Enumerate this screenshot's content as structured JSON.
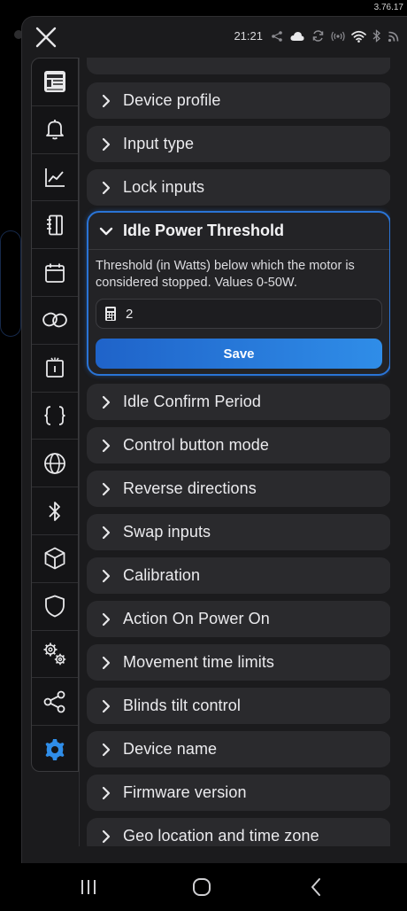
{
  "app_version": "3.76.17",
  "status_bar": {
    "time": "21:21",
    "icons": [
      "share-icon",
      "cloud-icon",
      "sync-icon",
      "radio-icon",
      "wifi-icon",
      "bluetooth-icon",
      "rss-icon"
    ]
  },
  "sidebar": {
    "items": [
      {
        "icon": "device-thumbnail",
        "active": false
      },
      {
        "icon": "bell-icon",
        "active": false
      },
      {
        "icon": "chart-icon",
        "active": false
      },
      {
        "icon": "log-book-icon",
        "active": false
      },
      {
        "icon": "calendar-icon",
        "active": false
      },
      {
        "icon": "link-icon",
        "active": false
      },
      {
        "icon": "switch-device-icon",
        "active": false
      },
      {
        "icon": "braces-icon",
        "active": false
      },
      {
        "icon": "globe-icon",
        "active": false
      },
      {
        "icon": "bluetooth-icon",
        "active": false
      },
      {
        "icon": "cube-icon",
        "active": false
      },
      {
        "icon": "shield-icon",
        "active": false
      },
      {
        "icon": "gears-icon",
        "active": false
      },
      {
        "icon": "share-nodes-icon",
        "active": false
      },
      {
        "icon": "settings-gear-icon",
        "active": true
      }
    ]
  },
  "settings": {
    "items_above": [
      "Device profile",
      "Input type",
      "Lock inputs"
    ],
    "expanded": {
      "title": "Idle Power Threshold",
      "description": "Threshold (in Watts) below which the motor is considered stopped. Values 0-50W.",
      "input_value": "2",
      "save_label": "Save"
    },
    "items_below": [
      "Idle Confirm Period",
      "Control button mode",
      "Reverse directions",
      "Swap inputs",
      "Calibration",
      "Action On Power On",
      "Movement time limits",
      "Blinds tilt control",
      "Device name",
      "Firmware version",
      "Geo location and time zone"
    ]
  },
  "colors": {
    "accent": "#2a74d6",
    "card": "#2a2a2d",
    "panel": "#1b1b1d",
    "active_icon": "#2f8de8"
  }
}
